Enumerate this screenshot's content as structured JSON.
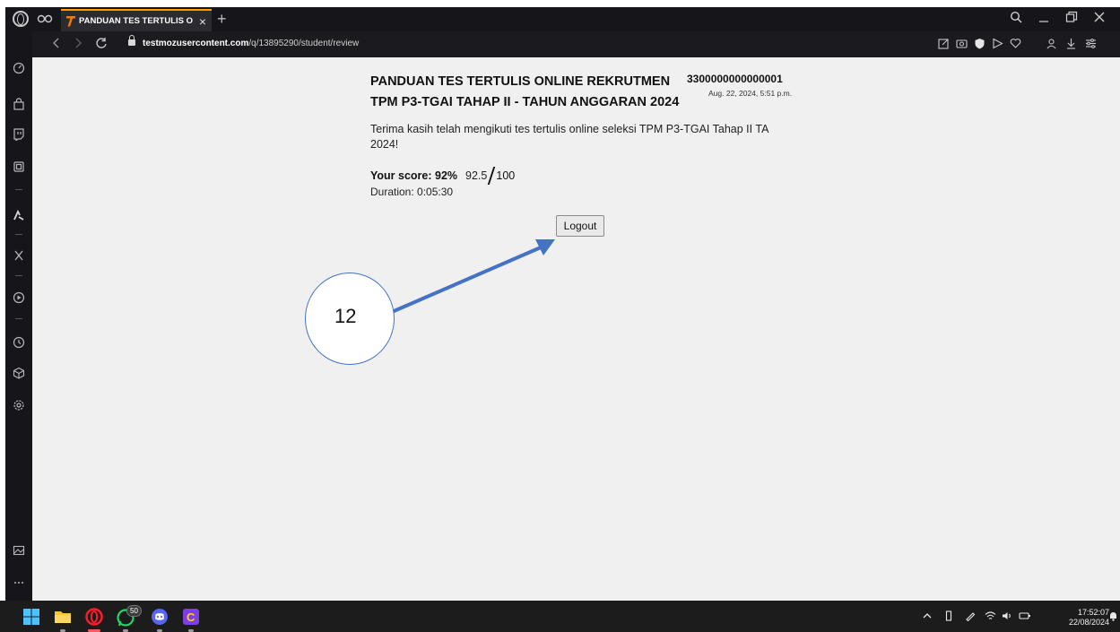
{
  "browser": {
    "tab_title": "PANDUAN TES TERTULIS O",
    "tab_close": "×",
    "new_tab": "+",
    "url_host": "testmozusercontent.com",
    "url_path": "/q/13895290/student/review"
  },
  "page": {
    "title_line1": "PANDUAN TES TERTULIS ONLINE REKRUTMEN",
    "title_line2": "TPM P3-TGAI TAHAP II - TAHUN ANGGARAN 2024",
    "candidate_id": "3300000000000001",
    "submitted_at": "Aug. 22, 2024, 5:51 p.m.",
    "thanks_message": "Terima kasih telah mengikuti tes tertulis online seleksi TPM P3-TGAI Tahap II TA 2024!",
    "score_label": "Your score: 92%",
    "score_points": "92.5",
    "score_max": "100",
    "score_percent": 92,
    "duration": "Duration: 0:05:30",
    "logout_label": "Logout"
  },
  "annotation": {
    "number": "12",
    "color": "#4472c4"
  },
  "taskbar": {
    "whatsapp_badge": "50",
    "time": "17:52:07",
    "date": "22/08/2024"
  },
  "colors": {
    "accent_tab": "#f5a000",
    "chrome_dark": "#16161a",
    "page_bg": "#f0f0f0"
  }
}
